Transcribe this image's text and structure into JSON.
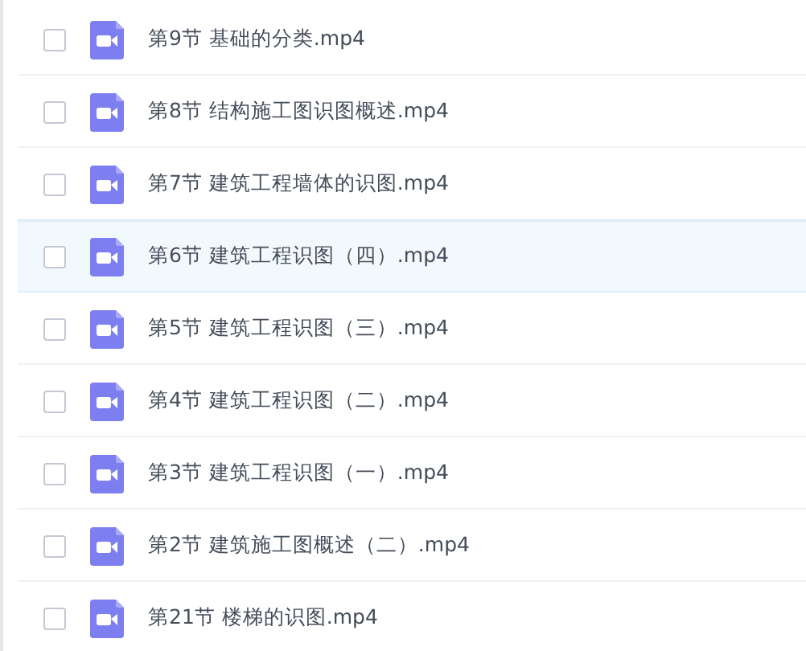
{
  "files": [
    {
      "name": "第9节 基础的分类.mp4",
      "checked": false,
      "selected": false
    },
    {
      "name": "第8节 结构施工图识图概述.mp4",
      "checked": false,
      "selected": false
    },
    {
      "name": "第7节 建筑工程墙体的识图.mp4",
      "checked": false,
      "selected": false
    },
    {
      "name": "第6节 建筑工程识图（四）.mp4",
      "checked": false,
      "selected": true
    },
    {
      "name": "第5节 建筑工程识图（三）.mp4",
      "checked": false,
      "selected": false
    },
    {
      "name": "第4节 建筑工程识图（二）.mp4",
      "checked": false,
      "selected": false
    },
    {
      "name": "第3节 建筑工程识图（一）.mp4",
      "checked": false,
      "selected": false
    },
    {
      "name": "第2节 建筑施工图概述（二）.mp4",
      "checked": false,
      "selected": false
    },
    {
      "name": "第21节 楼梯的识图.mp4",
      "checked": false,
      "selected": false
    }
  ]
}
